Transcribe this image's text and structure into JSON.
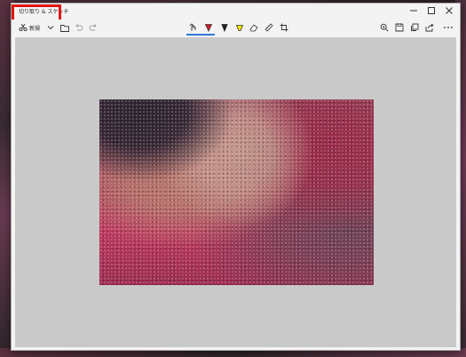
{
  "window": {
    "title": "切り取り & スケッチ"
  },
  "toolbar": {
    "new_label": "新規",
    "new_icon": "scissors-new-icon",
    "dropdown_icon": "chevron-down-icon",
    "open_icon": "folder-icon",
    "undo_icon": "undo-icon",
    "redo_icon": "redo-icon",
    "touch_write_icon": "touch-writing-icon",
    "ballpoint_pen_icon": "ballpoint-pen-icon",
    "pencil_icon": "pencil-icon",
    "highlighter_icon": "highlighter-icon",
    "eraser_icon": "eraser-icon",
    "ruler_icon": "ruler-icon",
    "crop_icon": "crop-icon",
    "zoom_icon": "zoom-icon",
    "save_icon": "save-icon",
    "copy_icon": "copy-icon",
    "share_icon": "share-icon",
    "more_icon": "more-icon"
  },
  "colors": {
    "ballpoint_pen": "#d21f2a",
    "pencil": "#222222",
    "highlighter": "#f2e600",
    "active_tab": "#2b79d6",
    "title_highlight": "#e01313"
  },
  "canvas": {
    "image_description_icon": "captured-image"
  }
}
